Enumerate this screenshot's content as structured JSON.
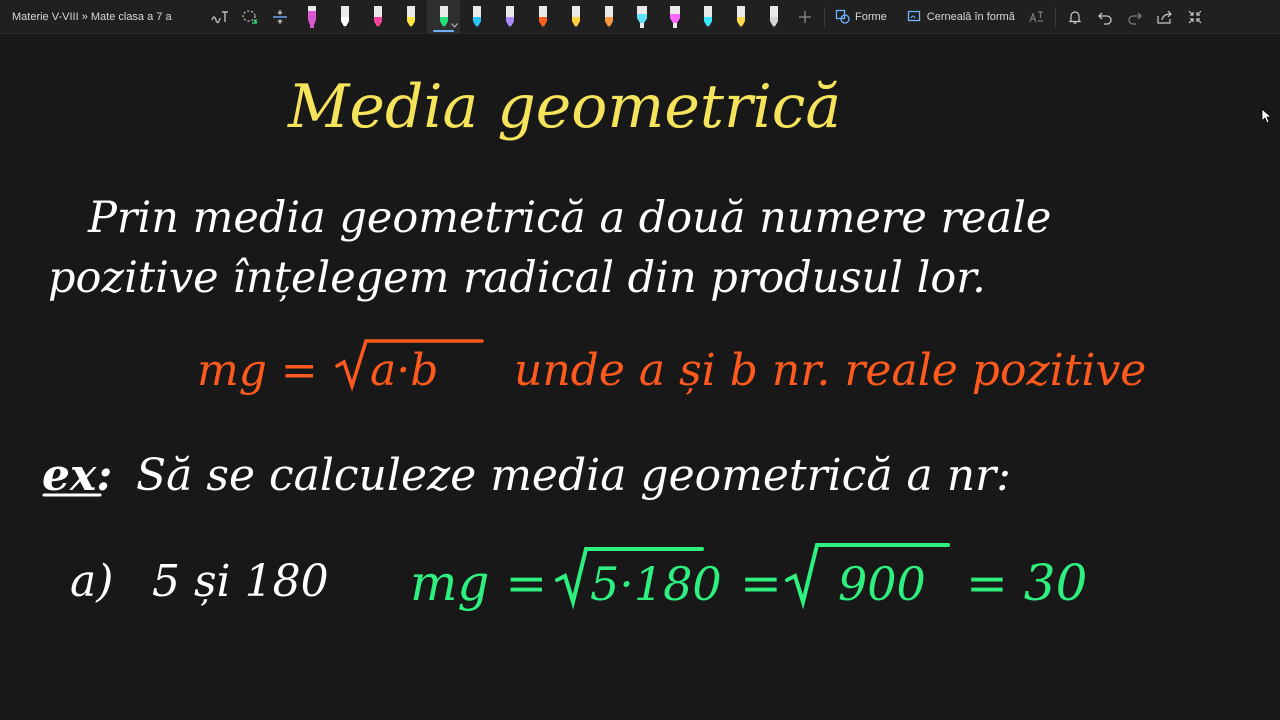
{
  "toolbar": {
    "breadcrumb": "Materie V-VIII » Mate clasa a 7 a",
    "shapes_label": "Forme",
    "ink_to_shape_label": "Cerneală în formă",
    "icons": [
      "ink-to-text-icon",
      "lasso-icon",
      "insert-space-icon",
      "undo-icon",
      "redo-icon",
      "share-icon",
      "fullscreen-icon",
      "bell-icon",
      "ink-to-math-icon"
    ],
    "pens": [
      {
        "color": "#d957d4",
        "kind": "marker"
      },
      {
        "color": "#ffffff",
        "kind": "pen"
      },
      {
        "color": "#ff3fa1",
        "kind": "pen"
      },
      {
        "color": "#ffe83f",
        "kind": "pen"
      },
      {
        "color": "#23e07a",
        "kind": "pen",
        "selected": true
      },
      {
        "color": "#27c7ff",
        "kind": "pen"
      },
      {
        "color": "#a98bff",
        "kind": "pen"
      },
      {
        "color": "#ff5d1f",
        "kind": "pen"
      },
      {
        "color": "#ffd23f",
        "kind": "pen"
      },
      {
        "color": "#ff9a3f",
        "kind": "pen"
      },
      {
        "color": "#5ce1ff",
        "kind": "highlighter"
      },
      {
        "color": "#ff66ff",
        "kind": "highlighter"
      },
      {
        "color": "#3de8ff",
        "kind": "pen"
      },
      {
        "color": "#ffd84a",
        "kind": "pen"
      },
      {
        "color": "#d6d6d6",
        "kind": "pen"
      }
    ]
  },
  "note": {
    "title": "Media geometrică",
    "definition_line1": "Prin media geometrică a două numere reale",
    "definition_line2": "pozitive înțelegem radical din produsul lor.",
    "formula_lhs": "mg =",
    "formula_radicand": "a·b",
    "formula_condition": "unde a și b nr. reale pozitive",
    "example_label": "ex:",
    "example_text": "Să se calculeze media geometrică a nr:",
    "item_label": "a)",
    "item_numbers": "5 și 180",
    "solution_lhs": "mg =",
    "solution_radicand1": "5·180",
    "solution_eq": "=",
    "solution_radicand2": "900",
    "solution_result": "= 30",
    "colors": {
      "title": "#f6e35c",
      "body": "#ffffff",
      "formula": "#ff5a1e",
      "solution": "#2ef07f"
    }
  }
}
